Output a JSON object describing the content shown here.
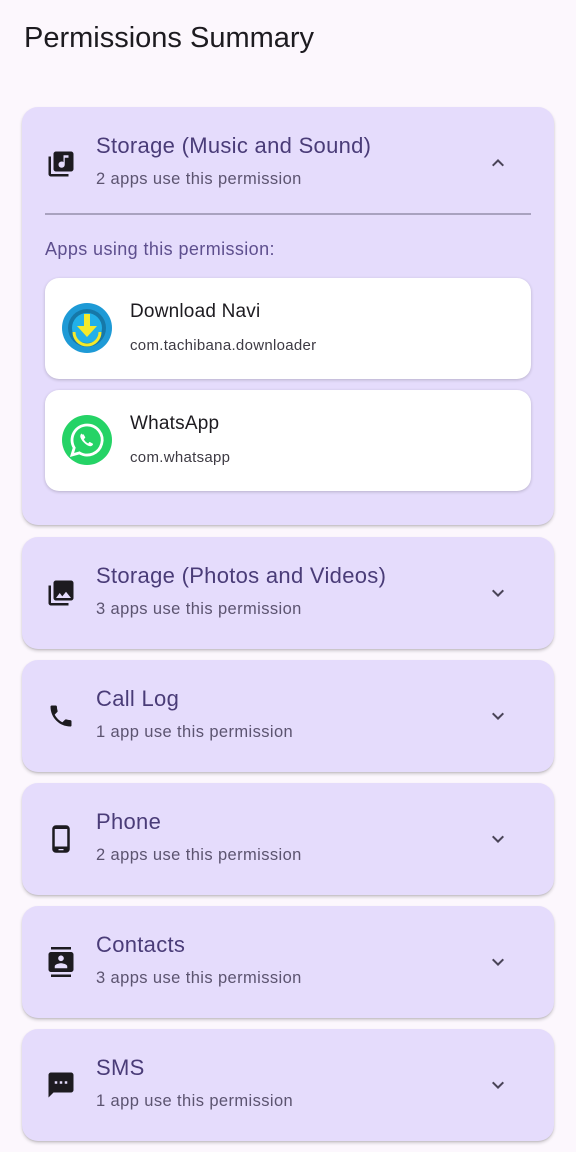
{
  "header": {
    "title": "Permissions Summary"
  },
  "expanded_section": {
    "title": "Storage (Music and Sound)",
    "subtitle": "2 apps use this permission",
    "icon": "music-library-icon",
    "apps_label": "Apps using this permission:",
    "apps": [
      {
        "name": "Download Navi",
        "package": "com.tachibana.downloader",
        "icon": "download-navi-app-icon"
      },
      {
        "name": "WhatsApp",
        "package": "com.whatsapp",
        "icon": "whatsapp-app-icon"
      }
    ]
  },
  "sections": [
    {
      "title": "Storage (Photos and Videos)",
      "subtitle": "3 apps use this permission",
      "icon": "photo-library-icon"
    },
    {
      "title": "Call Log",
      "subtitle": "1 app use this permission",
      "icon": "phone-call-icon"
    },
    {
      "title": "Phone",
      "subtitle": "2 apps use this permission",
      "icon": "smartphone-icon"
    },
    {
      "title": "Contacts",
      "subtitle": "3 apps use this permission",
      "icon": "contacts-icon"
    },
    {
      "title": "SMS",
      "subtitle": "1 app use this permission",
      "icon": "sms-icon"
    }
  ],
  "colors": {
    "background": "#fcf7fd",
    "card": "#e5dcfc",
    "title_text": "#4a3c78",
    "whatsapp_green": "#25d366",
    "download_navi_blue": "#1e9ad6"
  }
}
